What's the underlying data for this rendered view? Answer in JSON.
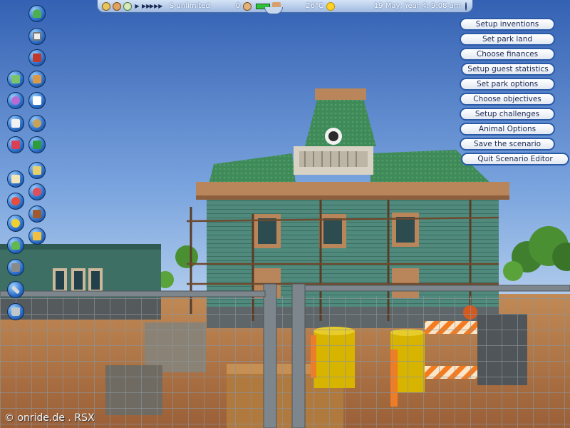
{
  "topbar": {
    "money": "$ unlimited",
    "guest_count": "0",
    "temperature": "26°C",
    "date_time": "19 May, Year 4:  9:08 am"
  },
  "icons": {
    "topbar": [
      "coin-icon",
      "pause-icon",
      "play-icon",
      "fast-forward-icon",
      "fastest-forward-icon",
      "guest-icon",
      "park-rating-bar-icon",
      "weather-sun-icon",
      "options-icon"
    ],
    "left_toolbar": [
      "scenery-tree-icon",
      "fence-icon",
      "path-brick-icon",
      "landscape-map-icon",
      "building-icon",
      "rides-icon",
      "dice-icon",
      "ticket-icon",
      "mascot-icon",
      "terrain-icon",
      "terrain-green-icon",
      "clipboard-icon",
      "camera-icon",
      "fireworks-icon",
      "staff-icon",
      "finance-icon",
      "research-icon",
      "guest-info-icon",
      "park-icon",
      "road-icon",
      "wrench-icon",
      "trash-icon"
    ]
  },
  "menu": {
    "items": [
      "Setup inventions",
      "Set park land",
      "Choose finances",
      "Setup guest statistics",
      "Set park options",
      "Choose objectives",
      "Setup challenges",
      "Animal Options",
      "Save the scenario",
      "Quit Scenario Editor"
    ]
  },
  "watermark": "© onride.de . RSX",
  "colors": {
    "menu_border": "#2a5aa8",
    "menu_text": "#1a2a55",
    "toolbar_blue": "#2c6fc9",
    "sky": "#3f6fbf",
    "ground": "#a4683f"
  }
}
